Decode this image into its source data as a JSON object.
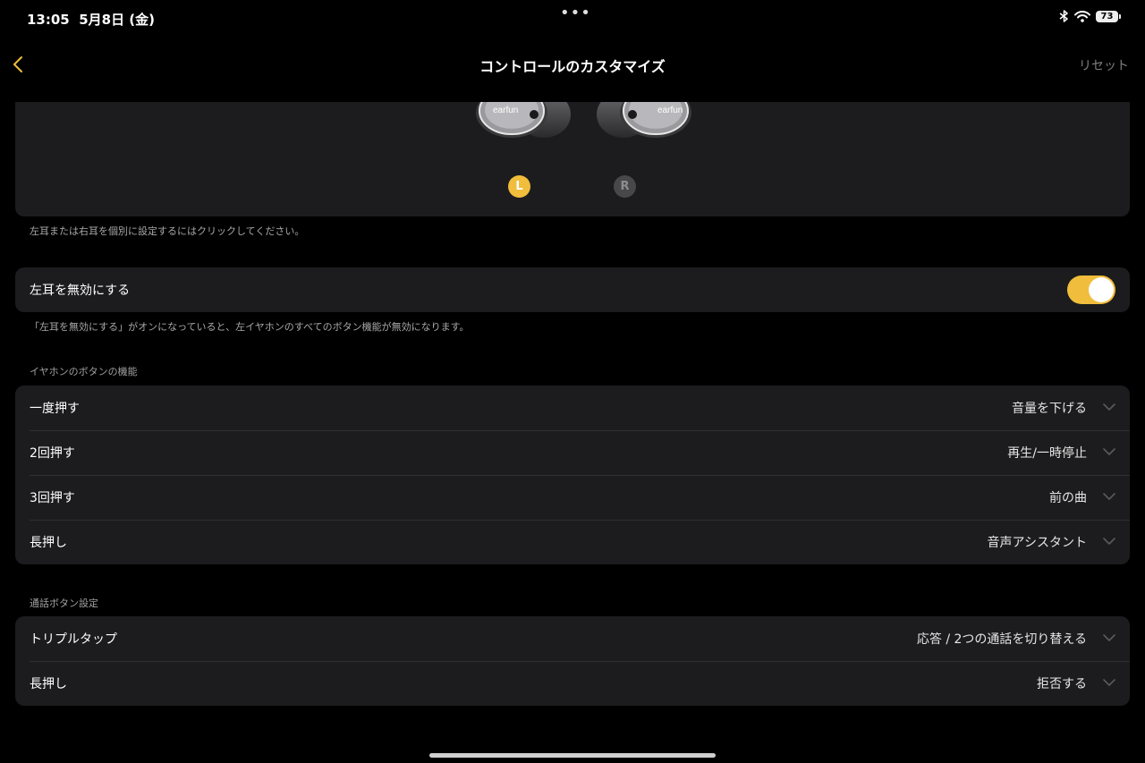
{
  "status_bar": {
    "time": "13:05",
    "date": "5月8日 (金)",
    "multitask_dots": "•••",
    "battery_level": "73",
    "icons": [
      "bluetooth-icon",
      "wifi-icon",
      "battery-icon"
    ]
  },
  "nav": {
    "title": "コントロールのカスタマイズ",
    "reset_label": "リセット"
  },
  "earbuds": {
    "brand_label": "earfun",
    "left_marker": "L",
    "right_marker": "R",
    "selected": "L",
    "hint": "左耳または右耳を個別に設定するにはクリックしてください。"
  },
  "disable_left": {
    "label": "左耳を無効にする",
    "enabled": true,
    "hint": "「左耳を無効にする」がオンになっていると、左イヤホンのすべてのボタン機能が無効になります。"
  },
  "button_functions": {
    "header": "イヤホンのボタンの機能",
    "rows": [
      {
        "label": "一度押す",
        "value": "音量を下げる"
      },
      {
        "label": "2回押す",
        "value": "再生/一時停止"
      },
      {
        "label": "3回押す",
        "value": "前の曲"
      },
      {
        "label": "長押し",
        "value": "音声アシスタント"
      }
    ]
  },
  "call_settings": {
    "header": "通話ボタン設定",
    "rows": [
      {
        "label": "トリプルタップ",
        "value": "応答 / 2つの通話を切り替える"
      },
      {
        "label": "長押し",
        "value": "拒否する"
      }
    ]
  },
  "colors": {
    "accent": "#f0bd3c",
    "card_background": "#1c1c1e",
    "page_background": "#000000"
  }
}
